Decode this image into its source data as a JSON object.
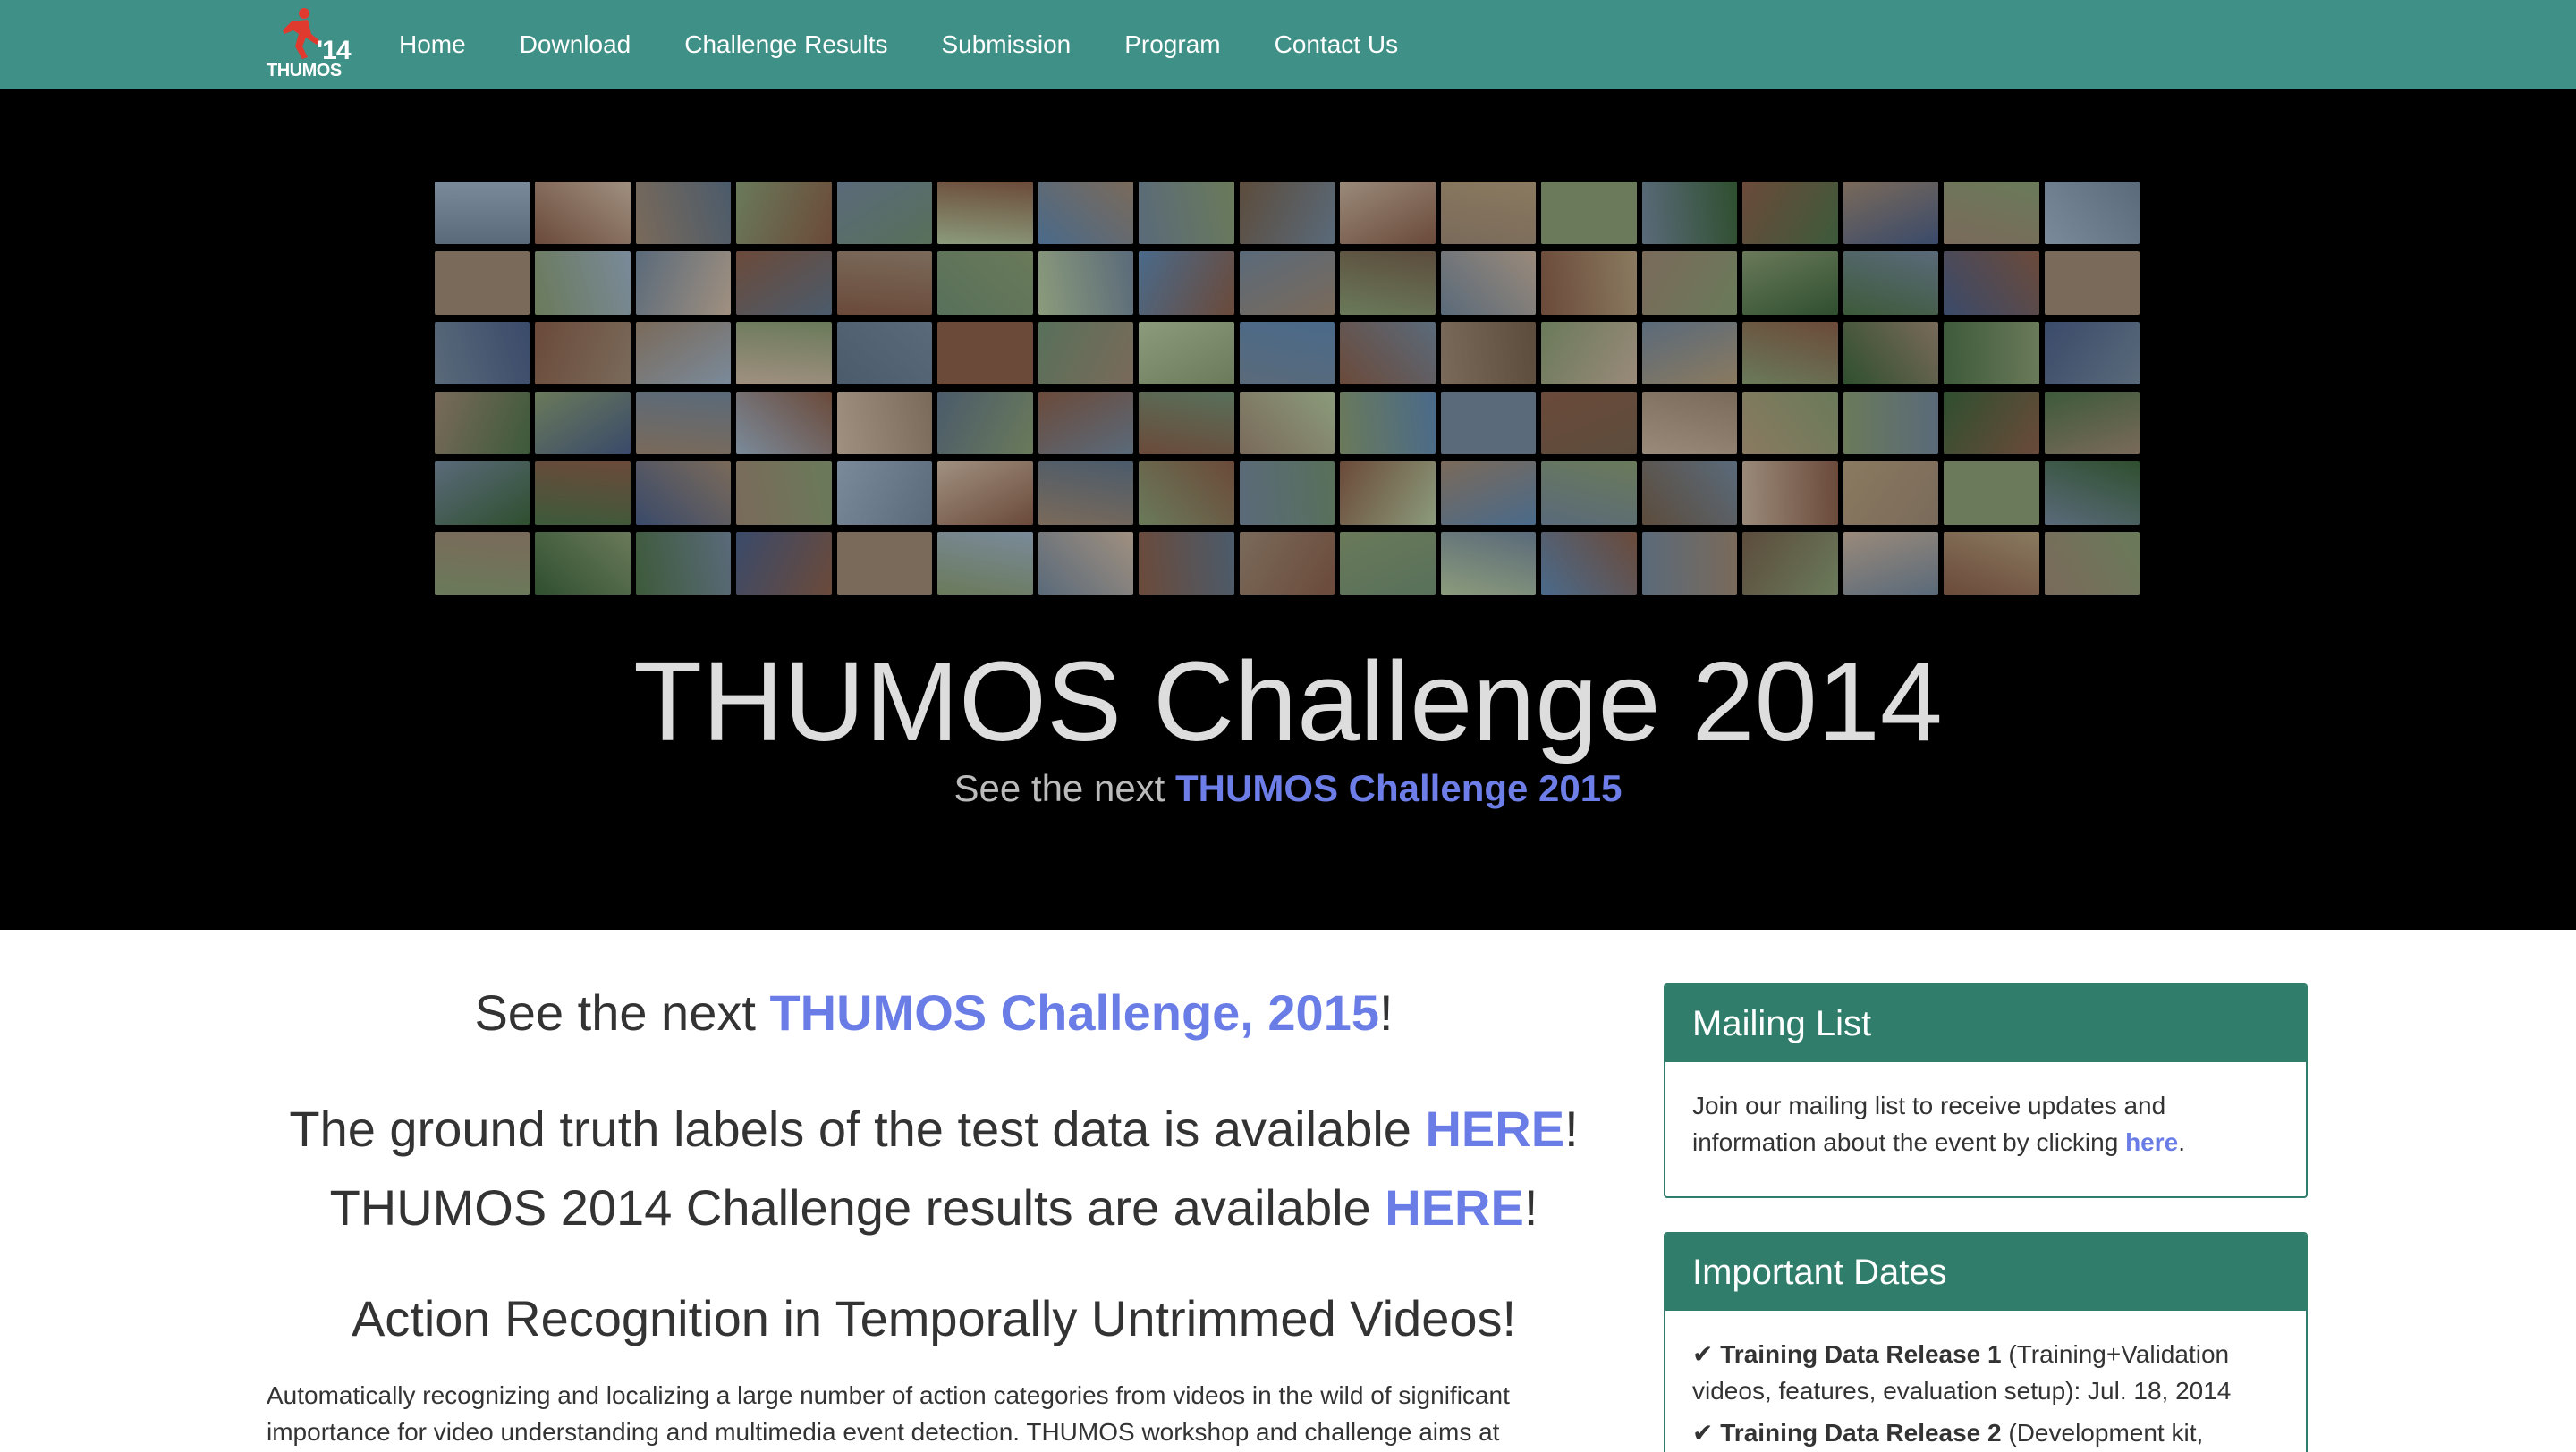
{
  "navbar": {
    "brand_number": "'14",
    "brand_text": "THUMOS",
    "links": [
      "Home",
      "Download",
      "Challenge Results",
      "Submission",
      "Program",
      "Contact Us"
    ]
  },
  "hero": {
    "title": "THUMOS Challenge 2014",
    "subtitle_prefix": "See the next ",
    "subtitle_link": "THUMOS Challenge 2015"
  },
  "main": {
    "next_prefix": "See the next ",
    "next_link": "THUMOS Challenge, 2015",
    "next_suffix": "!",
    "ground_truth_prefix": "The ground truth labels of the test data is available ",
    "ground_truth_link": "HERE",
    "ground_truth_suffix": "!",
    "results_prefix": "THUMOS 2014 Challenge results are available ",
    "results_link": "HERE",
    "results_suffix": "!",
    "section_title": "Action Recognition in Temporally Untrimmed Videos!",
    "paragraph": "Automatically recognizing and localizing a large number of action categories from videos in the wild of significant importance for video understanding and multimedia event detection. THUMOS workshop and challenge aims at"
  },
  "sidebar": {
    "mailing": {
      "title": "Mailing List",
      "text": "Join our mailing list to receive updates and information about the event by clicking ",
      "link": "here",
      "suffix": "."
    },
    "dates": {
      "title": "Important Dates",
      "items": [
        {
          "check": "✔",
          "label": "Training Data Release 1",
          "detail": " (Training+Validation videos, features, evaluation setup): Jul. 18, 2014"
        },
        {
          "check": "✔",
          "label": "Training Data Release 2",
          "detail": " (Development kit,"
        }
      ]
    }
  }
}
